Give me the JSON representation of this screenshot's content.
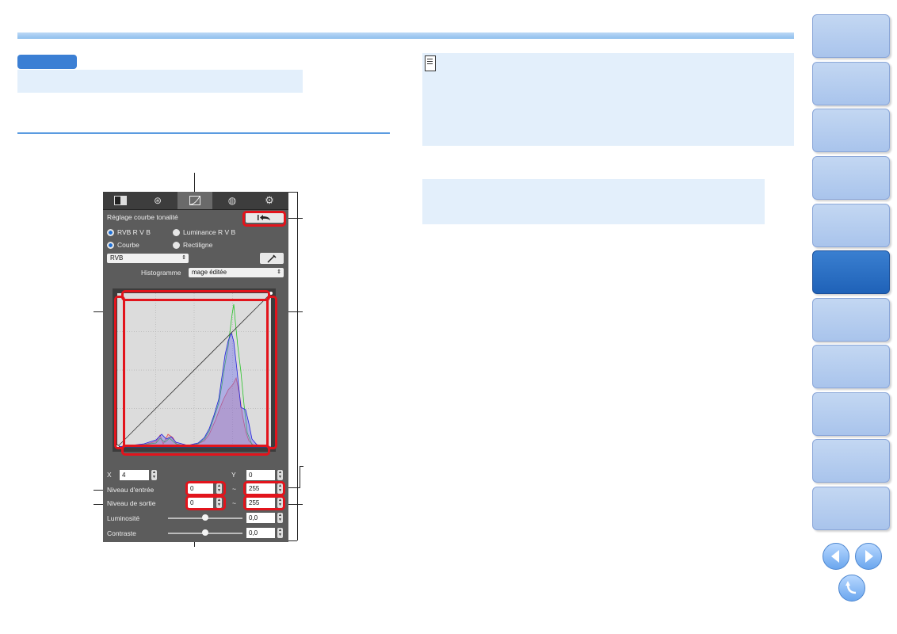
{
  "panel": {
    "tabs": [
      {
        "icon": "basic-adjust-icon"
      },
      {
        "icon": "sharpness-icon"
      },
      {
        "icon": "tone-curve-icon"
      },
      {
        "icon": "color-adjust-icon"
      },
      {
        "icon": "settings-gear-icon"
      }
    ],
    "title": "Réglage courbe tonalité",
    "mode_rgb": "RVB R V B",
    "mode_luminance": "Luminance R V B",
    "curve": "Courbe",
    "linear": "Rectiligne",
    "channel_select": "RVB",
    "histogram_label": "Histogramme",
    "histogram_select": "mage éditée",
    "x_label": "X",
    "x_value": "4",
    "y_label": "Y",
    "y_value": "0",
    "input_level_label": "Niveau d'entrée",
    "input_min": "0",
    "input_max": "255",
    "output_level_label": "Niveau de sortie",
    "output_min": "0",
    "output_max": "255",
    "tilde": "~",
    "brightness_label": "Luminosité",
    "brightness_value": "0,0",
    "brightness_level": 0.5,
    "contrast_label": "Contraste",
    "contrast_value": "0,0",
    "contrast_level": 0.5
  },
  "colors": {
    "accent_blue": "#3b7fd4",
    "highlight_red": "#e2141c",
    "sidebar_active": "#2a6fc5",
    "histogram_red": "#e64a4a",
    "histogram_green": "#27c427",
    "histogram_blue": "#2222dd"
  },
  "sidebar": {
    "tab_count": 11,
    "active_index": 5
  }
}
